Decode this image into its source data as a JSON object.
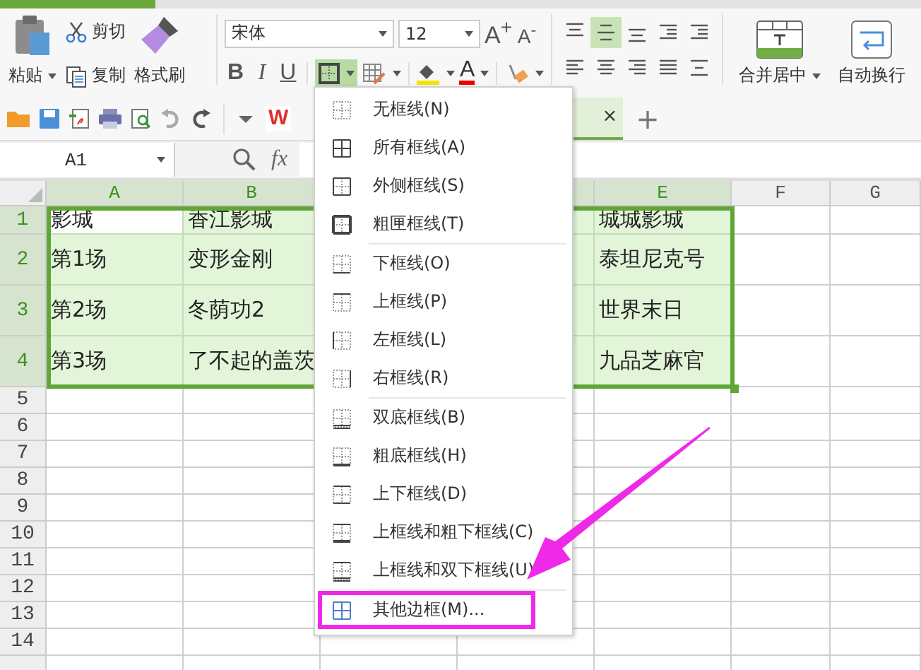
{
  "ribbon": {
    "clipboard": {
      "paste": "粘贴",
      "cut": "剪切",
      "copy": "复制",
      "format_painter": "格式刷"
    },
    "font": {
      "name": "宋体",
      "size": "12",
      "grow": "A$^{+}$",
      "shrink": "A$^{-}$",
      "bold": "B",
      "italic": "I",
      "underline": "U",
      "font_color": "A"
    },
    "border_button": {
      "active": true
    },
    "alignment": [
      {
        "kind": "top",
        "selected": false
      },
      {
        "kind": "middle",
        "selected": true
      },
      {
        "kind": "bottom",
        "selected": false
      },
      {
        "kind": "outdent",
        "selected": false
      },
      {
        "kind": "indent",
        "selected": false
      },
      {
        "kind": "left",
        "selected": false
      },
      {
        "kind": "center",
        "selected": false
      },
      {
        "kind": "right",
        "selected": false
      },
      {
        "kind": "justify",
        "selected": false
      },
      {
        "kind": "distributed",
        "selected": false
      }
    ],
    "merge": "合并居中",
    "wrap": "自动换行"
  },
  "quick_toolbar": {
    "logo": "W",
    "tab_close": "×",
    "new_tab": "+"
  },
  "formula_bar": {
    "name_box": "A1",
    "fx": "fx"
  },
  "sheet": {
    "columns": [
      {
        "label": "A",
        "selected": true
      },
      {
        "label": "B",
        "selected": true
      },
      {},
      {
        "selected": true
      },
      {
        "label": "E",
        "selected": true
      },
      {
        "label": "F",
        "selected": false
      },
      {
        "label": "G",
        "selected": false
      }
    ],
    "rows": [
      {
        "label": "1",
        "selected": true,
        "cells": [
          {
            "text": "影城",
            "active": true
          },
          {
            "text": "香江影城",
            "active": false
          },
          null,
          {
            "active": false
          },
          {
            "text": "城城影城",
            "active": false
          },
          null,
          null
        ]
      },
      {
        "label": "2",
        "selected": true,
        "cells": [
          {
            "text": "第1场",
            "active": false
          },
          {
            "text": "变形金刚",
            "active": false
          },
          null,
          {
            "active": false
          },
          {
            "text": "泰坦尼克号",
            "active": false
          },
          null,
          null
        ]
      },
      {
        "label": "3",
        "selected": true,
        "cells": [
          {
            "text": "第2场",
            "active": false
          },
          {
            "text": "冬荫功2",
            "active": false
          },
          null,
          {
            "active": false
          },
          {
            "text": "世界末日",
            "active": false
          },
          null,
          null
        ]
      },
      {
        "label": "4",
        "selected": true,
        "cells": [
          {
            "text": "第3场",
            "active": false
          },
          {
            "text": "了不起的盖茨",
            "active": false
          },
          null,
          {
            "active": false
          },
          {
            "text": "九品芝麻官",
            "active": false
          },
          null,
          null
        ]
      },
      {
        "label": "5",
        "selected": false
      },
      {
        "label": "6",
        "selected": false
      },
      {
        "label": "7",
        "selected": false
      },
      {
        "label": "8",
        "selected": false
      },
      {
        "label": "9",
        "selected": false
      },
      {
        "label": "10",
        "selected": false
      },
      {
        "label": "11",
        "selected": false
      },
      {
        "label": "12",
        "selected": false
      },
      {
        "label": "13",
        "selected": false
      },
      {
        "label": "14",
        "selected": false
      },
      {
        "selected": false
      }
    ]
  },
  "border_menu": {
    "items": [
      {
        "kind": "none",
        "label": "无框线(N)",
        "highlighted": false
      },
      {
        "kind": "all",
        "label": "所有框线(A)",
        "highlighted": false
      },
      {
        "kind": "outside",
        "label": "外侧框线(S)",
        "highlighted": false
      },
      {
        "kind": "thick_box",
        "label": "粗匣框线(T)",
        "highlighted": false
      },
      {
        "kind": "separator"
      },
      {
        "kind": "bottom",
        "label": "下框线(O)",
        "highlighted": false
      },
      {
        "kind": "top",
        "label": "上框线(P)",
        "highlighted": false
      },
      {
        "kind": "left",
        "label": "左框线(L)",
        "highlighted": false
      },
      {
        "kind": "right",
        "label": "右框线(R)",
        "highlighted": false
      },
      {
        "kind": "separator"
      },
      {
        "kind": "double_bottom",
        "label": "双底框线(B)",
        "highlighted": false
      },
      {
        "kind": "thick_bottom",
        "label": "粗底框线(H)",
        "highlighted": false
      },
      {
        "kind": "top_bottom",
        "label": "上下框线(D)",
        "highlighted": false
      },
      {
        "kind": "top_thick_bottom",
        "label": "上框线和粗下框线(C)",
        "highlighted": false
      },
      {
        "kind": "top_double_bottom",
        "label": "上框线和双下框线(U)",
        "highlighted": false
      },
      {
        "kind": "separator"
      },
      {
        "kind": "more",
        "label": "其他边框(M)...",
        "highlighted": true
      }
    ]
  }
}
